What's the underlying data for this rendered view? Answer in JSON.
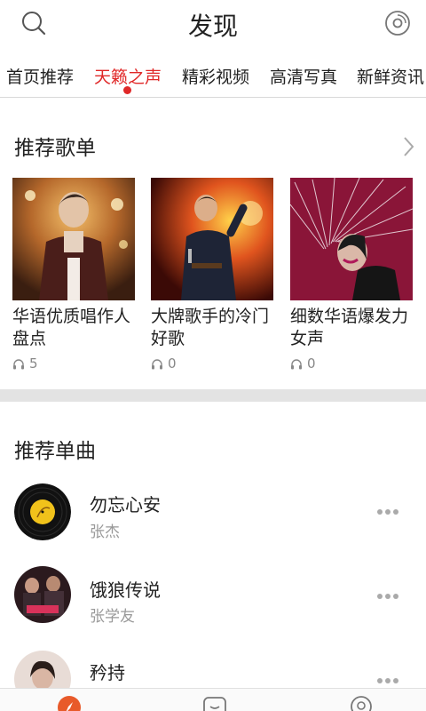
{
  "header": {
    "title": "发现",
    "left_icon": "search-icon",
    "right_icon": "disc-icon"
  },
  "tabs": [
    {
      "label": "首页推荐",
      "active": false
    },
    {
      "label": "天籁之声",
      "active": true
    },
    {
      "label": "精彩视频",
      "active": false
    },
    {
      "label": "高清写真",
      "active": false
    },
    {
      "label": "新鲜资讯",
      "active": false
    }
  ],
  "playlists": {
    "title": "推荐歌单",
    "items": [
      {
        "name": "华语优质唱作人盘点",
        "plays": "5"
      },
      {
        "name": "大牌歌手的冷门好歌",
        "plays": "0"
      },
      {
        "name": "细数华语爆发力女声",
        "plays": "0"
      }
    ]
  },
  "songs": {
    "title": "推荐单曲",
    "items": [
      {
        "title": "勿忘心安",
        "artist": "张杰"
      },
      {
        "title": "饿狼传说",
        "artist": "张学友"
      },
      {
        "title": "矜持",
        "artist": ""
      }
    ]
  },
  "colors": {
    "accent": "#e02828",
    "divider": "#e3e3e3"
  },
  "bottom_nav": [
    "compass-icon",
    "chat-icon",
    "location-icon"
  ]
}
